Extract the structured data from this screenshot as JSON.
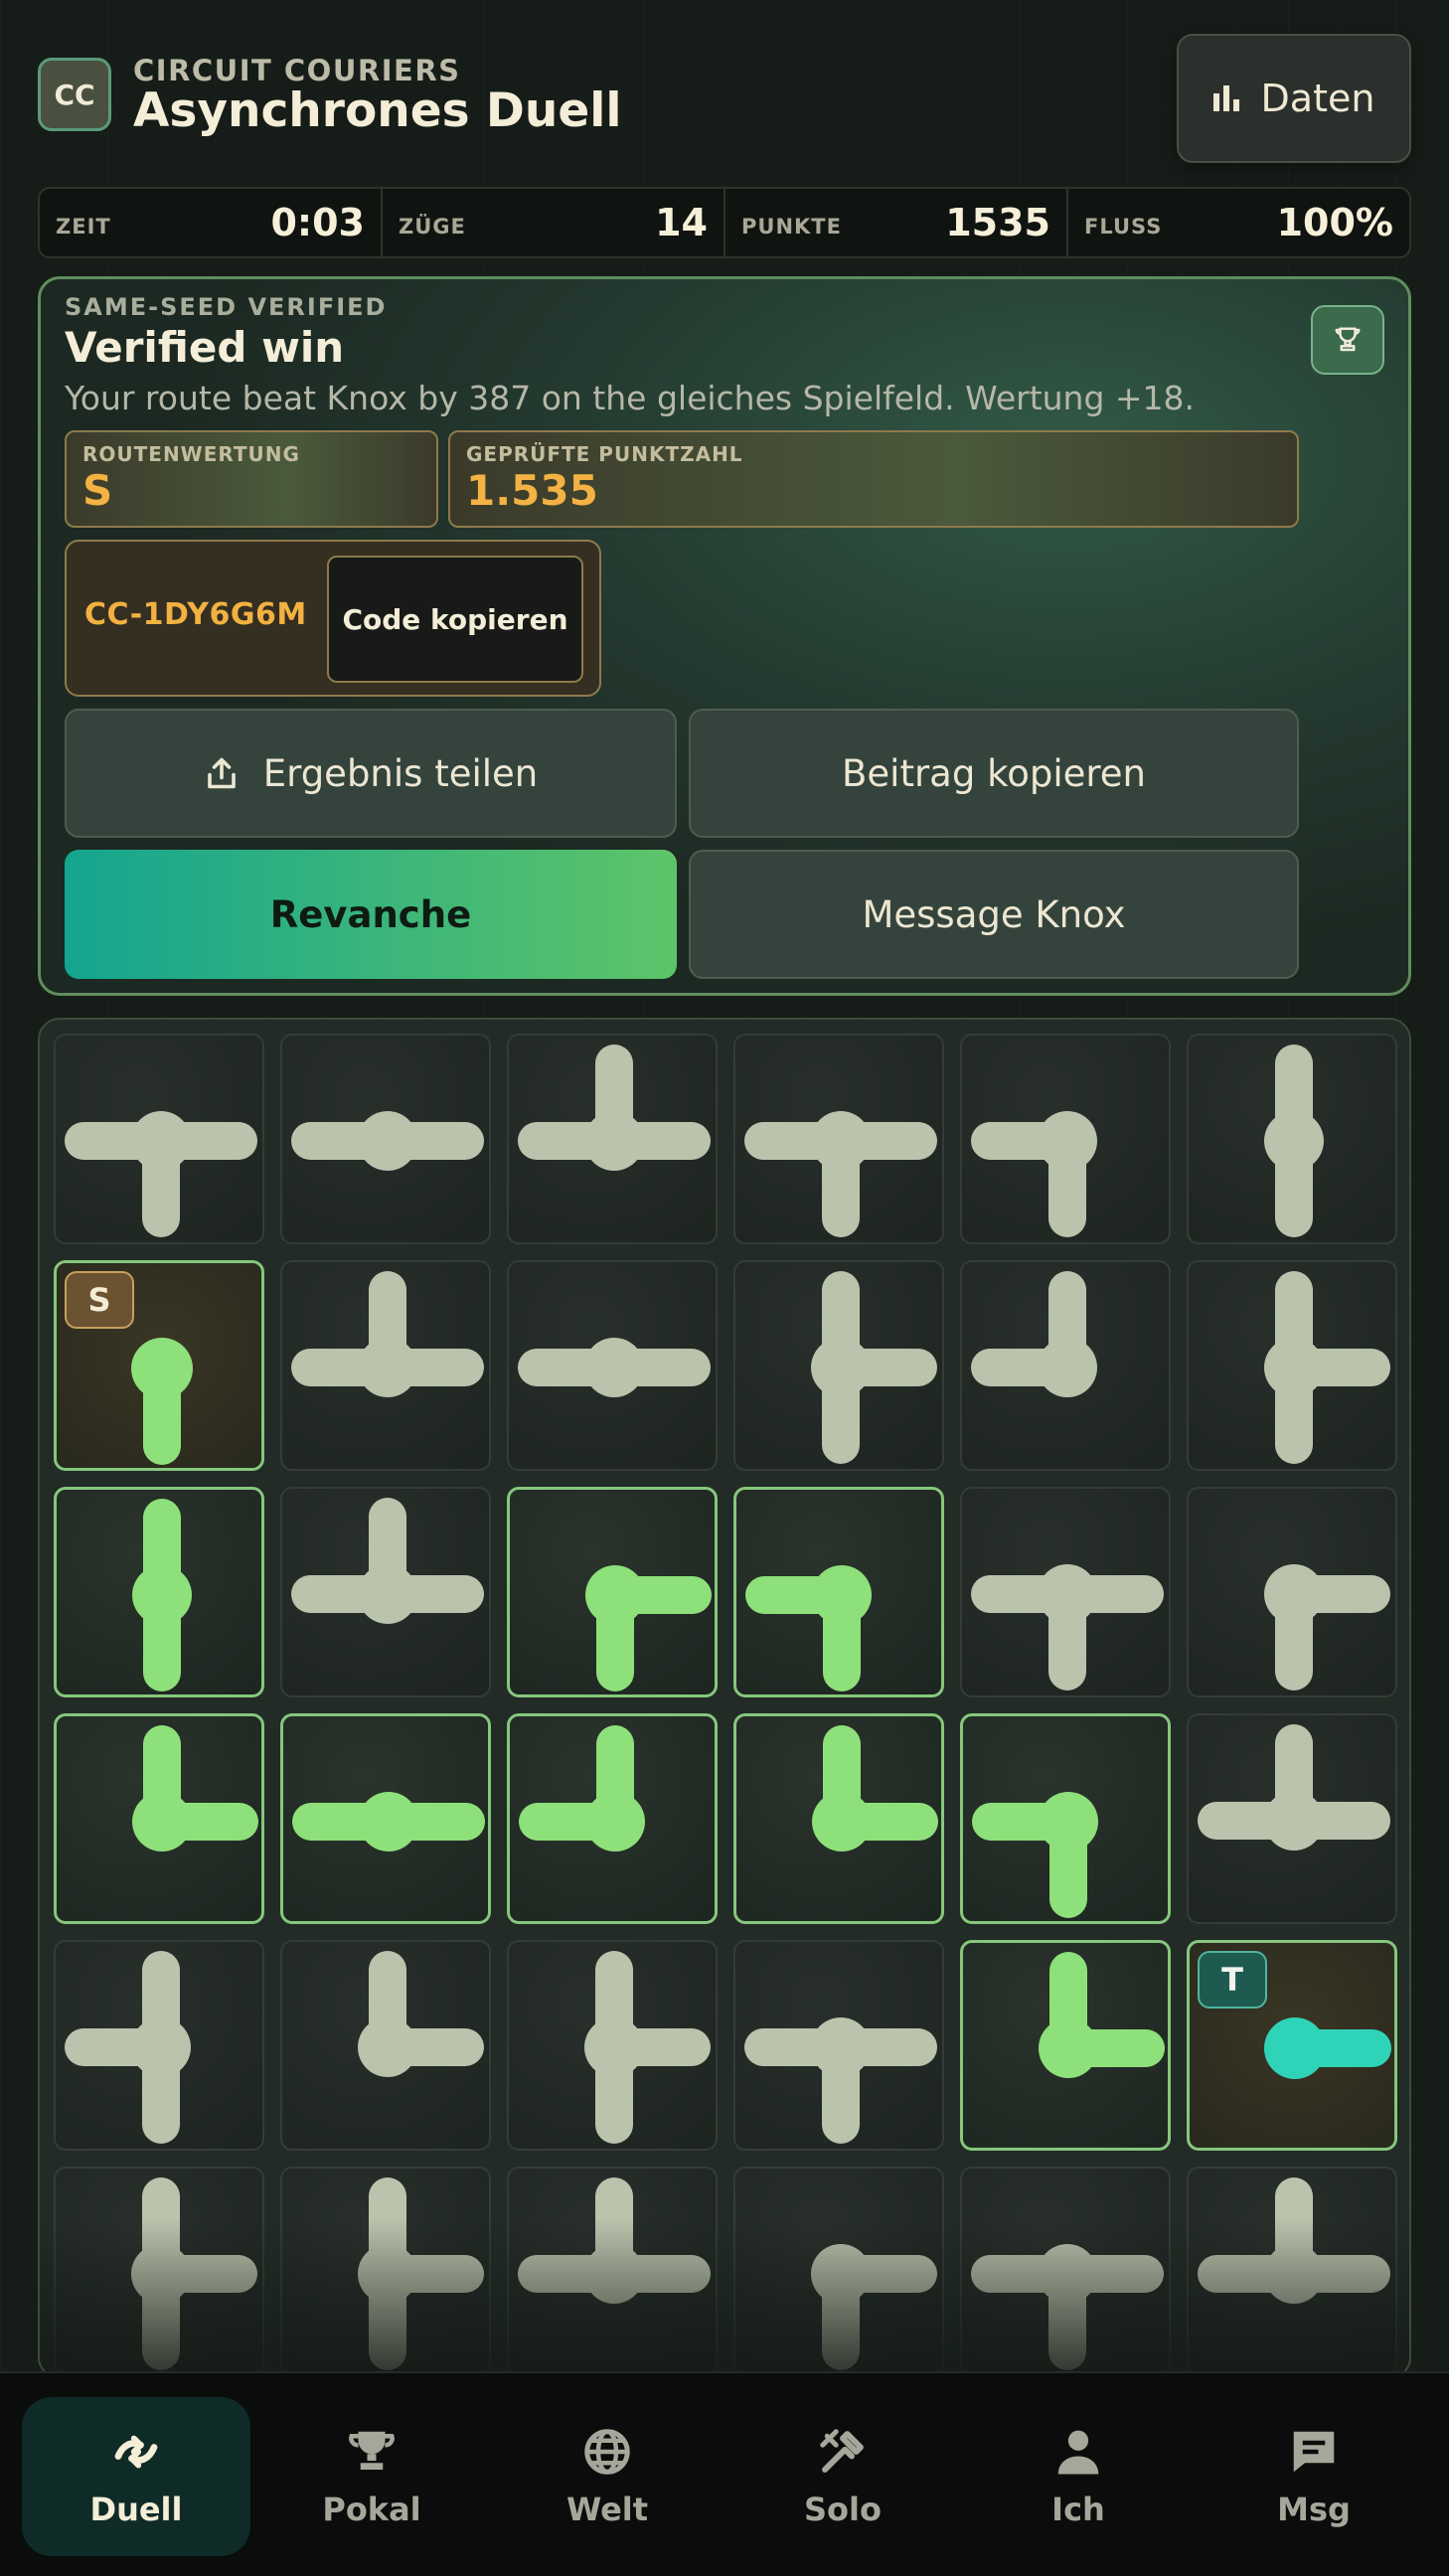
{
  "header": {
    "logo": "CC",
    "brand": "CIRCUIT COURIERS",
    "title": "Asynchrones Duell",
    "data_button": "Daten",
    "data_icon": "bar-chart-icon"
  },
  "stats": [
    {
      "label": "ZEIT",
      "value": "0:03"
    },
    {
      "label": "ZÜGE",
      "value": "14"
    },
    {
      "label": "PUNKTE",
      "value": "1535"
    },
    {
      "label": "FLUSS",
      "value": "100%"
    }
  ],
  "result": {
    "tag": "SAME-SEED VERIFIED",
    "title": "Verified win",
    "description": "Your route beat Knox by 387 on the gleiches Spielfeld. Wertung +18.",
    "trophy_icon": "trophy-icon",
    "grade_label": "ROUTENWERTUNG",
    "grade_value": "S",
    "score_label": "GEPRÜFTE PUNKTZAHL",
    "score_value": "1.535",
    "code": "CC-1DY6G6M",
    "copy_code": "Code kopieren",
    "share": "Ergebnis teilen",
    "share_icon": "share-icon",
    "copy_post": "Beitrag kopieren",
    "rematch": "Revanche",
    "message": "Message Knox"
  },
  "board": {
    "rows": 6,
    "cols": 6,
    "start_label": "S",
    "target_label": "T",
    "colors": {
      "idle": "#bac4ad",
      "powered": "#8ee07a",
      "target": "#2fd4b8"
    },
    "tiles": [
      {
        "c": "LRD"
      },
      {
        "c": "LR"
      },
      {
        "c": "ULR"
      },
      {
        "c": "LRD"
      },
      {
        "c": "LD"
      },
      {
        "c": "UD"
      },
      {
        "c": "D",
        "s": "start",
        "p": true
      },
      {
        "c": "ULR"
      },
      {
        "c": "LR"
      },
      {
        "c": "UDR"
      },
      {
        "c": "UL"
      },
      {
        "c": "UDR"
      },
      {
        "c": "UD",
        "p": true
      },
      {
        "c": "ULR"
      },
      {
        "c": "RD",
        "p": true
      },
      {
        "c": "LD",
        "p": true
      },
      {
        "c": "LRD"
      },
      {
        "c": "RD"
      },
      {
        "c": "UR",
        "p": true
      },
      {
        "c": "LR",
        "p": true
      },
      {
        "c": "UL",
        "p": true
      },
      {
        "c": "UR",
        "p": true
      },
      {
        "c": "LD",
        "p": true
      },
      {
        "c": "ULR"
      },
      {
        "c": "UDL"
      },
      {
        "c": "UR"
      },
      {
        "c": "UDR"
      },
      {
        "c": "LRD"
      },
      {
        "c": "UR",
        "p": true
      },
      {
        "c": "R",
        "s": "target",
        "p": true
      },
      {
        "c": "UDR"
      },
      {
        "c": "UDR"
      },
      {
        "c": "ULR"
      },
      {
        "c": "RD"
      },
      {
        "c": "LRD"
      },
      {
        "c": "ULR"
      }
    ]
  },
  "nav": [
    {
      "label": "Duell",
      "icon": "duel-icon",
      "active": true
    },
    {
      "label": "Pokal",
      "icon": "trophy-icon",
      "active": false
    },
    {
      "label": "Welt",
      "icon": "globe-icon",
      "active": false
    },
    {
      "label": "Solo",
      "icon": "tools-icon",
      "active": false
    },
    {
      "label": "Ich",
      "icon": "person-icon",
      "active": false
    },
    {
      "label": "Msg",
      "icon": "message-icon",
      "active": false
    }
  ]
}
